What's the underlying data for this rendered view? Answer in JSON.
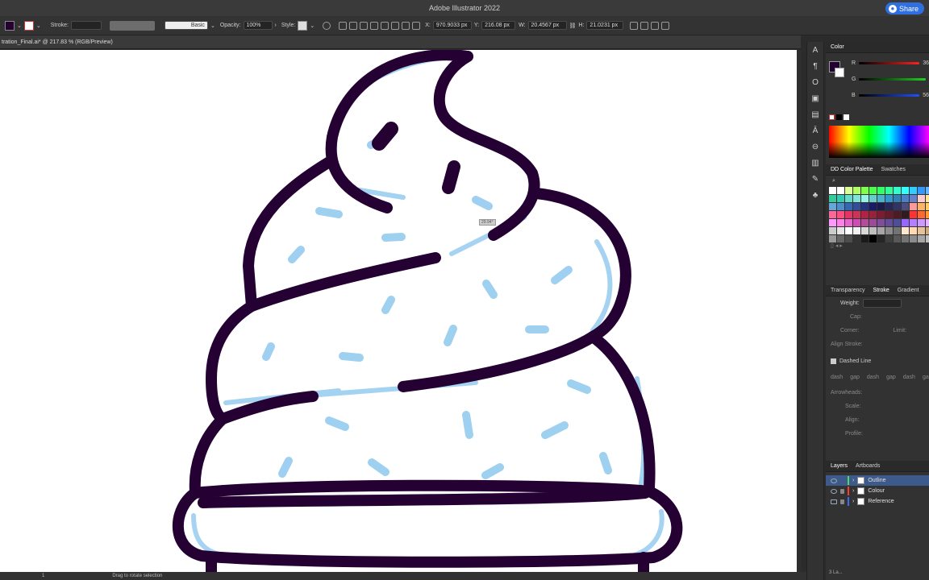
{
  "app": {
    "title": "Adobe Illustrator 2022",
    "share_label": "Share"
  },
  "control_bar": {
    "stroke_label": "Stroke:",
    "brush_label": "Basic",
    "opacity_label": "Opacity:",
    "opacity_value": "100%",
    "style_label": "Style:",
    "x_label": "X:",
    "x_value": "970.9033 px",
    "y_label": "Y:",
    "y_value": "216.08 px",
    "w_label": "W:",
    "w_value": "20.4567 px",
    "h_label": "H:",
    "h_value": "21.0231 px"
  },
  "document": {
    "tab_title": "tration_Final.ai* @ 217.83 % (RGB/Preview)",
    "rotate_tooltip": "29.94°"
  },
  "status_bar": {
    "artboard_number": "1",
    "hint_text": "Drag to rotate selection"
  },
  "color_panel": {
    "title": "Color",
    "r_label": "R",
    "g_label": "G",
    "b_label": "B",
    "r_value": "36",
    "b_value": "56",
    "fill_color": "#240033"
  },
  "swatch_panel": {
    "tabs": [
      "DD Color Palette",
      "Swatches"
    ],
    "colors": [
      "#ffffff",
      "#ffffff",
      "#d9ff99",
      "#b3ff66",
      "#80ff4d",
      "#4dff4d",
      "#33ff66",
      "#33ff99",
      "#33ffcc",
      "#33ffff",
      "#33ccff",
      "#3399ff",
      "#66b3ff",
      "#33cc99",
      "#33ccb3",
      "#66d9cc",
      "#80e6d9",
      "#99f2e6",
      "#66cccc",
      "#4db3cc",
      "#3399cc",
      "#3380b3",
      "#4d80cc",
      "#6680cc",
      "#ffcccc",
      "#ffe699",
      "#66a6d9",
      "#4d8fcc",
      "#3366b3",
      "#334d99",
      "#263380",
      "#1a1a66",
      "#1a1a4d",
      "#262659",
      "#333366",
      "#4d4d80",
      "#ff9999",
      "#ffb366",
      "#ffcc66",
      "#ff6699",
      "#ff4d80",
      "#e63366",
      "#cc3355",
      "#b32244",
      "#99223b",
      "#801a33",
      "#661a2b",
      "#4d1a26",
      "#331a1f",
      "#ff3333",
      "#ff6633",
      "#ff9933",
      "#ff99ff",
      "#ff80e6",
      "#e666cc",
      "#cc4db3",
      "#b34d99",
      "#994d99",
      "#804d99",
      "#664d99",
      "#4d4d99",
      "#9966ff",
      "#b380ff",
      "#cc99ff",
      "#e6b3ff",
      "#cccccc",
      "#e6e6e6",
      "#ffffff",
      "#f2f2f2",
      "#d9d9d9",
      "#bfbfbf",
      "#a6a6a6",
      "#8c8c8c",
      "#737373",
      "#ffe6cc",
      "#ffd9b3",
      "#e6c299",
      "#ccaa80",
      "#999999",
      "#666666",
      "#4d4d4d",
      "#333333",
      "#1a1a1a",
      "#000000",
      "#262626",
      "#404040",
      "#595959",
      "#737373",
      "#8c8c8c",
      "#a6a6a6",
      "#bfbfbf"
    ]
  },
  "appearance_tabs": [
    "Transparency",
    "Stroke",
    "Gradient"
  ],
  "stroke_panel": {
    "weight_label": "Weight:",
    "cap_label": "Cap:",
    "corner_label": "Corner:",
    "limit_label": "Limit:",
    "align_label": "Align Stroke:",
    "dashed_label": "Dashed Line",
    "dash_gap": [
      "dash",
      "gap",
      "dash",
      "gap",
      "dash",
      "gap"
    ],
    "arrowheads_label": "Arrowheads:",
    "scale_label": "Scale:",
    "align2_label": "Align:",
    "profile_label": "Profile:"
  },
  "layers_panel": {
    "tabs": [
      "Layers",
      "Artboards"
    ],
    "layers": [
      {
        "name": "Outline",
        "color": "#4cd964"
      },
      {
        "name": "Colour",
        "color": "#ff3b30"
      },
      {
        "name": "Reference",
        "color": "#3a6df0"
      }
    ],
    "footer": "3 La..."
  },
  "colors": {
    "outline": "#240033",
    "sprinkle": "#8ec8ee",
    "accent": "#2f6fe0"
  }
}
